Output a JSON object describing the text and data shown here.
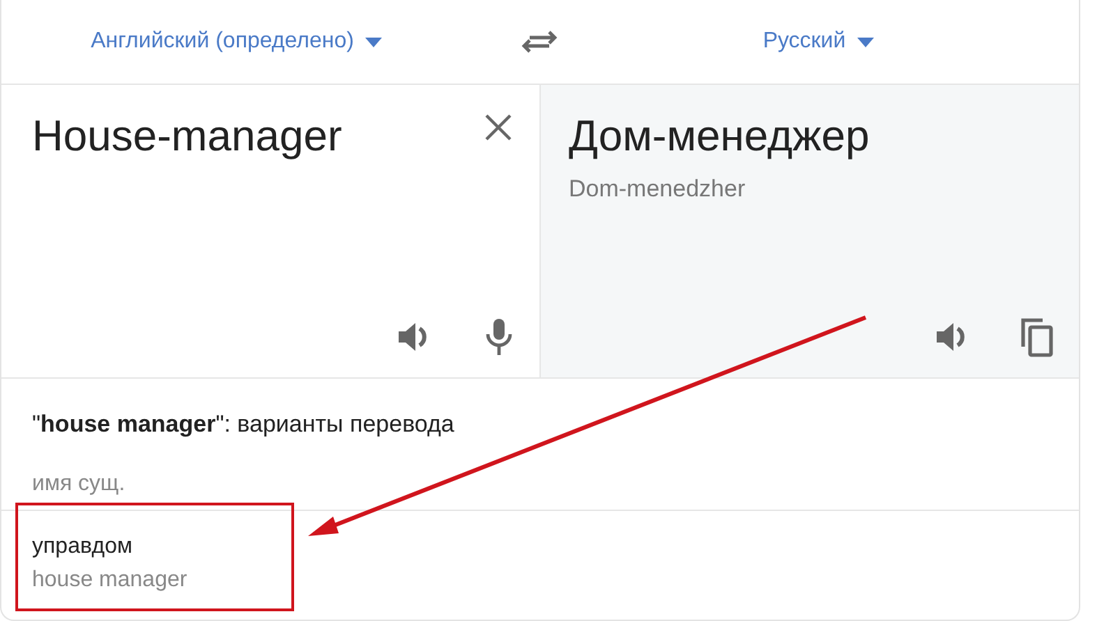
{
  "languages": {
    "source": "Английский (определено)",
    "target": "Русский"
  },
  "source": {
    "text": "House-manager"
  },
  "translation": {
    "text": "Дом-менеджер",
    "transliteration": "Dom-menedzher"
  },
  "dictionary": {
    "heading": "\"**house manager**\": варианты перевода",
    "part_of_speech": "имя сущ.",
    "entries": [
      {
        "word": "управдом",
        "back_translation": "house manager",
        "highlighted": true
      }
    ]
  }
}
